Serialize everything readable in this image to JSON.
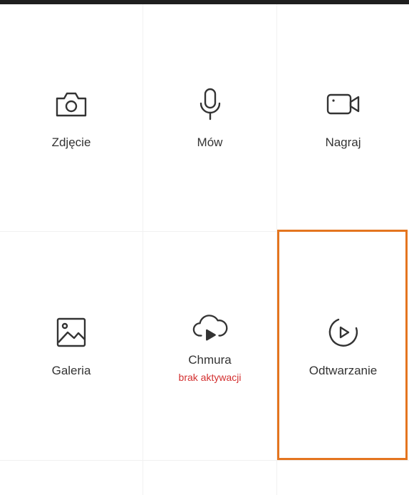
{
  "colors": {
    "accent_highlight": "#e4751f",
    "warning_text": "#d32f2f",
    "label_text": "#333333",
    "icon_stroke": "#333333"
  },
  "tiles": [
    {
      "id": "photo",
      "label": "Zdjęcie",
      "icon": "camera-icon"
    },
    {
      "id": "speak",
      "label": "Mów",
      "icon": "microphone-icon"
    },
    {
      "id": "record",
      "label": "Nagraj",
      "icon": "video-camera-icon"
    },
    {
      "id": "gallery",
      "label": "Galeria",
      "icon": "image-icon"
    },
    {
      "id": "cloud",
      "label": "Chmura",
      "sublabel": "brak aktywacji",
      "icon": "cloud-play-icon"
    },
    {
      "id": "playback",
      "label": "Odtwarzanie",
      "icon": "play-circle-icon"
    }
  ]
}
